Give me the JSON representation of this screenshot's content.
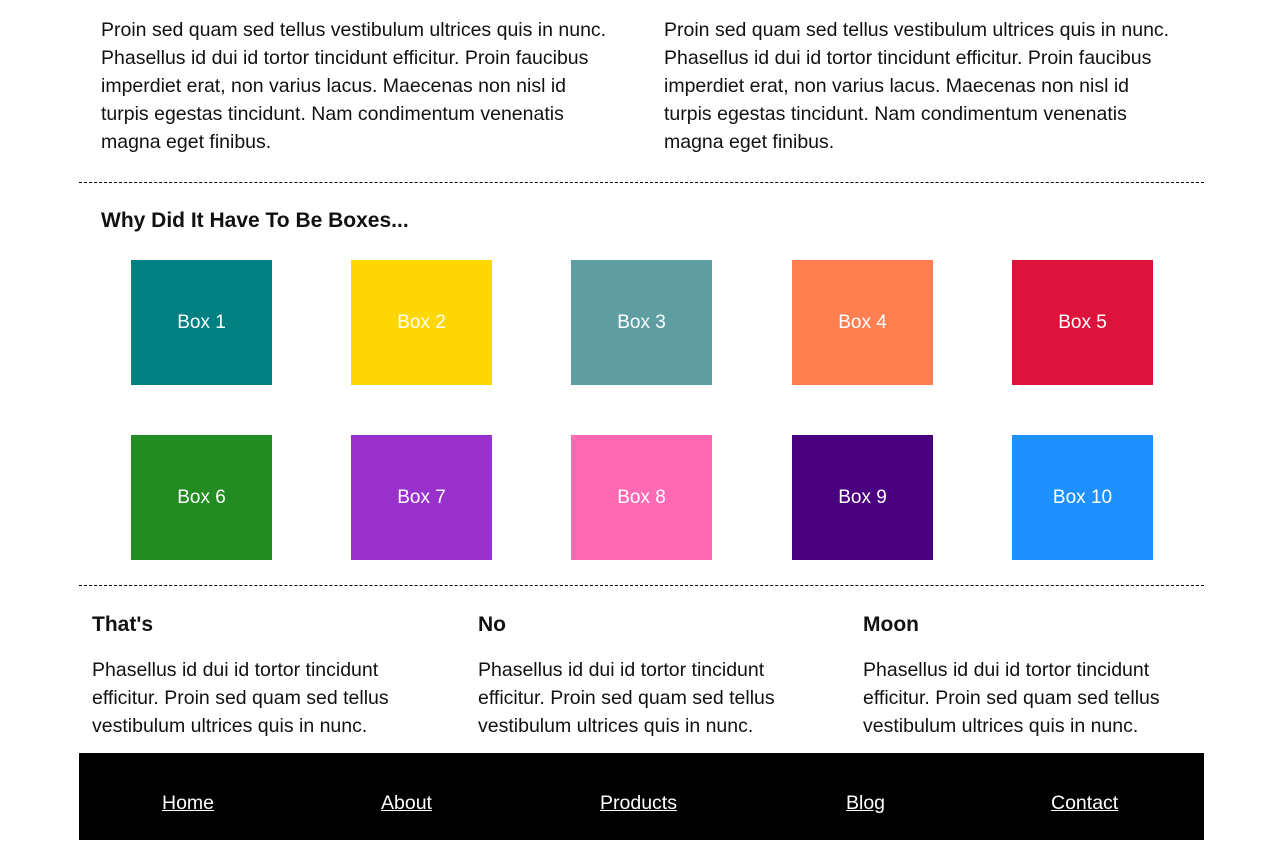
{
  "intro": {
    "column_1": "Proin sed quam sed tellus vestibulum ultrices quis in nunc. Phasellus id dui id tortor tincidunt efficitur. Proin faucibus imperdiet erat, non varius lacus. Maecenas non nisl id turpis egestas tincidunt. Nam condimentum venenatis magna eget finibus.",
    "column_2": "Proin sed quam sed tellus vestibulum ultrices quis in nunc. Phasellus id dui id tortor tincidunt efficitur. Proin faucibus imperdiet erat, non varius lacus. Maecenas non nisl id turpis egestas tincidunt. Nam condimentum venenatis magna eget finibus."
  },
  "boxes_section": {
    "heading": "Why Did It Have To Be Boxes...",
    "boxes": [
      {
        "label": "Box 1",
        "color": "#008080"
      },
      {
        "label": "Box 2",
        "color": "#FFD700"
      },
      {
        "label": "Box 3",
        "color": "#5F9EA0"
      },
      {
        "label": "Box 4",
        "color": "#FF7F50"
      },
      {
        "label": "Box 5",
        "color": "#DC143C"
      },
      {
        "label": "Box 6",
        "color": "#228B22"
      },
      {
        "label": "Box 7",
        "color": "#9932CC"
      },
      {
        "label": "Box 8",
        "color": "#FF69B4"
      },
      {
        "label": "Box 9",
        "color": "#4B0082"
      },
      {
        "label": "Box 10",
        "color": "#1E90FF"
      }
    ]
  },
  "columns": [
    {
      "title": "That's",
      "text": "Phasellus id dui id tortor tincidunt efficitur. Proin sed quam sed tellus vestibulum ultrices quis in nunc."
    },
    {
      "title": "No",
      "text": "Phasellus id dui id tortor tincidunt efficitur. Proin sed quam sed tellus vestibulum ultrices quis in nunc."
    },
    {
      "title": "Moon",
      "text": "Phasellus id dui id tortor tincidunt efficitur. Proin sed quam sed tellus vestibulum ultrices quis in nunc."
    }
  ],
  "footer": {
    "links": [
      "Home",
      "About",
      "Products",
      "Blog",
      "Contact"
    ]
  }
}
